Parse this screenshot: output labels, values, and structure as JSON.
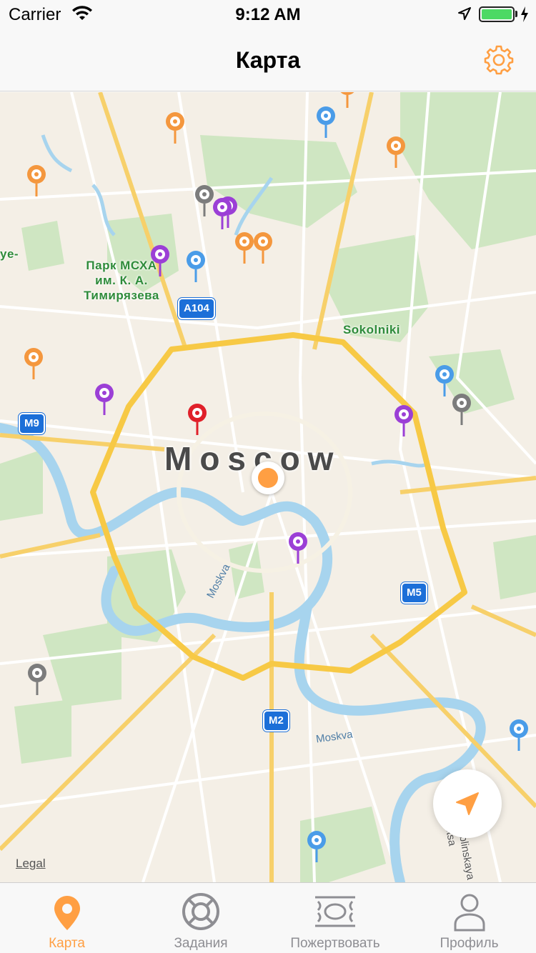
{
  "status_bar": {
    "carrier": "Carrier",
    "time": "9:12 AM",
    "battery_level": 1.0
  },
  "nav": {
    "title": "Карта",
    "settings_icon": "gear-icon"
  },
  "map": {
    "city": "Moscow",
    "parks": [
      {
        "name": "Парк МСХА\nим. К. А.\nТимирязева"
      },
      {
        "name": "Sokolniki"
      }
    ],
    "partial_label": "ye-",
    "road_shields": [
      "A104",
      "M9",
      "M5",
      "M2"
    ],
    "rivers": [
      "Moskva",
      "Moskva"
    ],
    "street": "Lyublinskaya ulitsa",
    "legal": "Legal",
    "pin_colors": {
      "orange": "#f4973e",
      "blue": "#4a9ce8",
      "purple": "#9b3fd6",
      "gray": "#7c7c7c",
      "red": "#e0202a"
    },
    "pins": [
      {
        "color": "orange"
      },
      {
        "color": "blue"
      },
      {
        "color": "orange"
      },
      {
        "color": "orange"
      },
      {
        "color": "gray"
      },
      {
        "color": "purple"
      },
      {
        "color": "purple"
      },
      {
        "color": "orange"
      },
      {
        "color": "orange"
      },
      {
        "color": "purple"
      },
      {
        "color": "blue"
      },
      {
        "color": "orange"
      },
      {
        "color": "purple"
      },
      {
        "color": "red"
      },
      {
        "color": "blue"
      },
      {
        "color": "gray"
      },
      {
        "color": "purple"
      },
      {
        "color": "purple"
      },
      {
        "color": "gray"
      },
      {
        "color": "blue"
      },
      {
        "color": "blue"
      },
      {
        "color": "orange"
      }
    ],
    "locate_button_icon": "location-arrow-icon"
  },
  "tabs": [
    {
      "label": "Карта",
      "icon": "map-pin-icon",
      "active": true
    },
    {
      "label": "Задания",
      "icon": "lifebuoy-icon",
      "active": false
    },
    {
      "label": "Пожертвовать",
      "icon": "banknote-icon",
      "active": false
    },
    {
      "label": "Профиль",
      "icon": "person-icon",
      "active": false
    }
  ],
  "colors": {
    "accent": "#ff9f43",
    "tab_inactive": "#8e8e93",
    "ring_road": "#f7c945",
    "water": "#a7d4ee",
    "park": "#bfe0b0",
    "map_bg": "#f4efe6"
  }
}
